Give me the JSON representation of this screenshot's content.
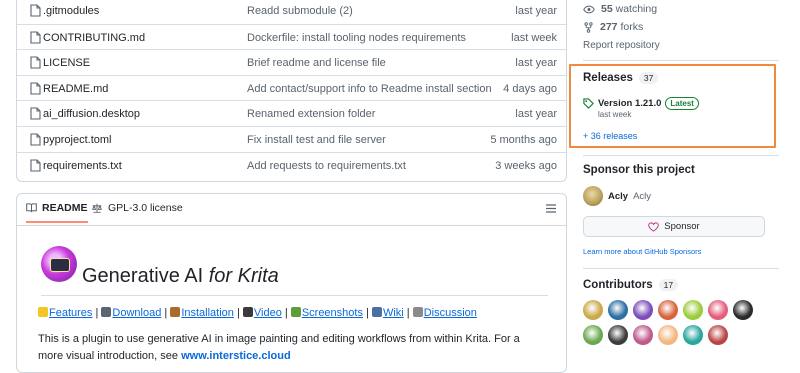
{
  "files": [
    {
      "name": ".gitmodules",
      "message": "Readd submodule (2)",
      "time": "last year"
    },
    {
      "name": "CONTRIBUTING.md",
      "message": "Dockerfile: install tooling nodes requirements",
      "time": "last week"
    },
    {
      "name": "LICENSE",
      "message": "Brief readme and license file",
      "time": "last year"
    },
    {
      "name": "README.md",
      "message": "Add contact/support info to Readme install section",
      "time": "4 days ago"
    },
    {
      "name": "ai_diffusion.desktop",
      "message": "Renamed extension folder",
      "time": "last year"
    },
    {
      "name": "pyproject.toml",
      "message": "Fix install test and file server",
      "time": "5 months ago"
    },
    {
      "name": "requirements.txt",
      "message": "Add requests to requirements.txt",
      "time": "3 weeks ago"
    }
  ],
  "readme": {
    "tab_readme": "README",
    "tab_license": "GPL-3.0 license",
    "title_main": "Generative AI ",
    "title_em": "for Krita",
    "links": [
      {
        "label": "Features",
        "icon": "sparkles-icon"
      },
      {
        "label": "Download",
        "icon": "download-arrow-icon"
      },
      {
        "label": "Installation",
        "icon": "tools-icon"
      },
      {
        "label": "Video",
        "icon": "film-icon"
      },
      {
        "label": "Screenshots",
        "icon": "picture-icon"
      },
      {
        "label": "Wiki",
        "icon": "book-icon"
      },
      {
        "label": "Discussion",
        "icon": "speech-bubble-icon"
      }
    ],
    "separator": " | ",
    "desc_text": "This is a plugin to use generative AI in image painting and editing workflows from within Krita. For a more visual introduction, see ",
    "desc_link": "www.interstice.cloud"
  },
  "sidebar": {
    "watching_count": "55",
    "watching_label": "watching",
    "forks_count": "277",
    "forks_label": "forks",
    "report": "Report repository",
    "releases_title": "Releases",
    "releases_count": "37",
    "release_version": "Version 1.21.0",
    "latest_badge": "Latest",
    "release_time": "last week",
    "more_releases": "+ 36 releases",
    "sponsor_title": "Sponsor this project",
    "sponsor_login": "Acly",
    "sponsor_name": "Acly",
    "sponsor_button": "Sponsor",
    "learn_more": "Learn more about GitHub Sponsors",
    "contributors_title": "Contributors",
    "contributors_count": "17",
    "contributor_colors": [
      "#c9a94a",
      "#2d6ea3",
      "#7c4dbb",
      "#d8643c",
      "#9ccc3c",
      "#e45d7a",
      "#2b2b2b",
      "#6aa84f",
      "#3c3c3c",
      "#c05a8c",
      "#f2b880",
      "#2aa6a0",
      "#b94646"
    ]
  },
  "colors": {
    "highlight_border": "#f0883e",
    "link": "#0969da",
    "latest_green": "#1a7f37",
    "heart_pink": "#bf3989"
  }
}
